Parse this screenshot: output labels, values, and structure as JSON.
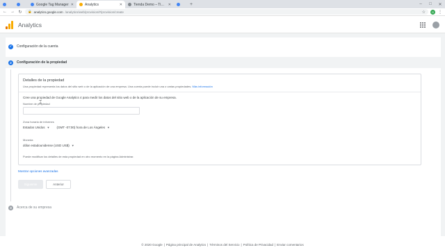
{
  "browser": {
    "tabs": [
      {
        "label": "G",
        "active": false,
        "small": true
      },
      {
        "label": "G",
        "active": false,
        "small": true
      },
      {
        "label": "Google Tag Manager",
        "active": false,
        "small": false
      },
      {
        "label": "Analytics",
        "active": true,
        "small": false
      },
      {
        "label": "Tienda Demo – Tienda Curso U...",
        "active": false,
        "small": false
      },
      {
        "label": "",
        "active": false,
        "small": true
      }
    ],
    "new_tab": "+",
    "url_host": "analytics.google.com",
    "url_path": "/analytics/web/provision/#/provision/create",
    "profile_initial": "G"
  },
  "header": {
    "title": "Analytics"
  },
  "steps": {
    "step1": {
      "number": "✓",
      "label": "Configuración de la cuenta"
    },
    "step2": {
      "number": "2",
      "label": "Configuración de la propiedad"
    },
    "step3": {
      "number": "3",
      "label": "Acerca de su empresa"
    }
  },
  "card": {
    "title": "Detalles de la propiedad",
    "desc": "Una propiedad representa los datos del sitio web o de la aplicación de una empresa. Una cuenta puede incluir una o varias propiedades.",
    "desc_link": "Más información",
    "intro": "Cree una propiedad de Google Analytics 4 para medir los datos del sitio web o de la aplicación de su empresa.",
    "name_label": "Nombre de propiedad",
    "name_value": "",
    "tz_label": "Zona horaria de informes",
    "country": "Estados Unidos",
    "timezone": "(GMT -07:00) hora de Los Ángeles",
    "currency_label": "Moneda",
    "currency": "dólar estadounidense (USD US$)",
    "footnote": "Puede modificar los detalles de esta propiedad en otro momento en la página Administrar."
  },
  "advanced_link": "Mostrar opciones avanzadas",
  "buttons": {
    "next": "Siguiente",
    "back": "Anterior"
  },
  "footer": {
    "copyright": "© 2020 Google",
    "links": [
      "Página principal de Analytics",
      "Términos del Servicio",
      "Política de Privacidad",
      "Enviar comentarios"
    ]
  }
}
